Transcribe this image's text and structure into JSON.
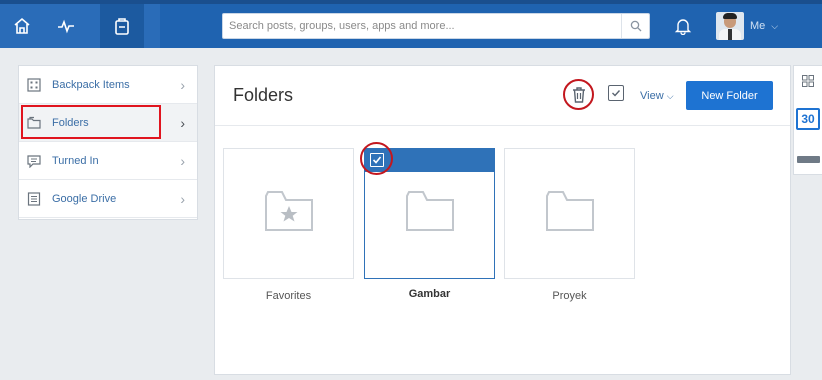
{
  "topbar": {
    "nav": [
      {
        "name": "home",
        "icon": "home-icon"
      },
      {
        "name": "activity",
        "icon": "pulse-icon"
      },
      {
        "name": "backpack",
        "icon": "backpack-icon",
        "active": true
      }
    ],
    "search": {
      "placeholder": "Search posts, groups, users, apps and more..."
    },
    "user": {
      "label": "Me"
    }
  },
  "sidebar": {
    "items": [
      {
        "label": "Backpack Items",
        "icon": "grid-icon"
      },
      {
        "label": "Folders",
        "icon": "folder-icon",
        "active": true
      },
      {
        "label": "Turned In",
        "icon": "chat-icon"
      },
      {
        "label": "Google Drive",
        "icon": "document-icon"
      }
    ]
  },
  "main": {
    "title": "Folders",
    "view_label": "View",
    "new_folder_label": "New Folder",
    "folders": [
      {
        "name": "Favorites",
        "icon": "star-folder-icon"
      },
      {
        "name": "Gambar",
        "selected": true
      },
      {
        "name": "Proyek"
      }
    ]
  },
  "rail": {
    "calendar_day": "30"
  },
  "colors": {
    "accent": "#1e73d2",
    "topbar": "#1f63b0",
    "highlight": "#e0141e"
  }
}
